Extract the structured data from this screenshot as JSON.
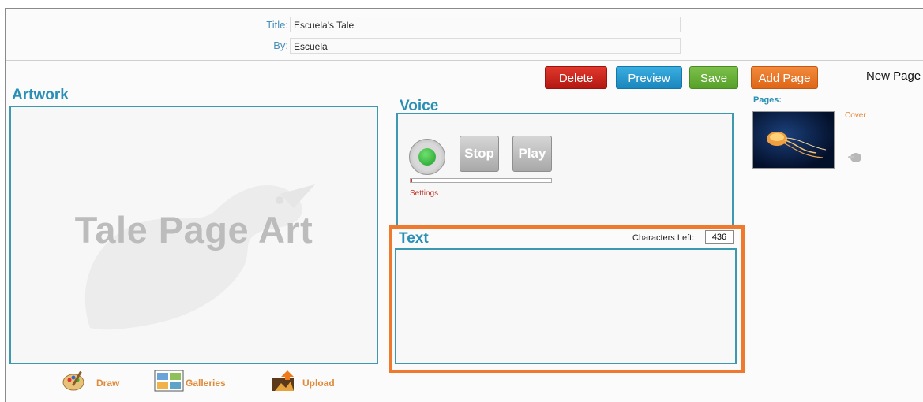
{
  "header": {
    "title_label": "Title:",
    "title_value": "Escuela's Tale",
    "by_label": "By:",
    "by_value": "Escuela"
  },
  "toolbar": {
    "delete_label": "Delete",
    "preview_label": "Preview",
    "save_label": "Save",
    "add_page_label": "Add Page",
    "new_page_label": "New Page"
  },
  "artwork": {
    "heading": "Artwork",
    "placeholder": "Tale Page Art",
    "tools": [
      {
        "label": "Draw",
        "icon": "palette-icon"
      },
      {
        "label": "Galleries",
        "icon": "gallery-icon"
      },
      {
        "label": "Upload",
        "icon": "upload-icon"
      }
    ]
  },
  "voice": {
    "heading": "Voice",
    "record_icon": "record-icon",
    "stop_label": "Stop",
    "play_label": "Play",
    "progress": 0.01,
    "settings_label": "Settings"
  },
  "text_section": {
    "heading": "Text",
    "chars_left_label": "Characters Left:",
    "chars_left_value": "436",
    "content": ""
  },
  "pages": {
    "heading": "Pages:",
    "items": [
      {
        "label": "Cover",
        "thumb": "jellyfish-thumbnail"
      }
    ]
  },
  "colors": {
    "accent": "#2a8fb5",
    "delete": "#c4211a",
    "preview": "#2a9dd0",
    "save": "#67ad35",
    "add_page": "#e8742a",
    "highlight": "#ef7a2e"
  }
}
